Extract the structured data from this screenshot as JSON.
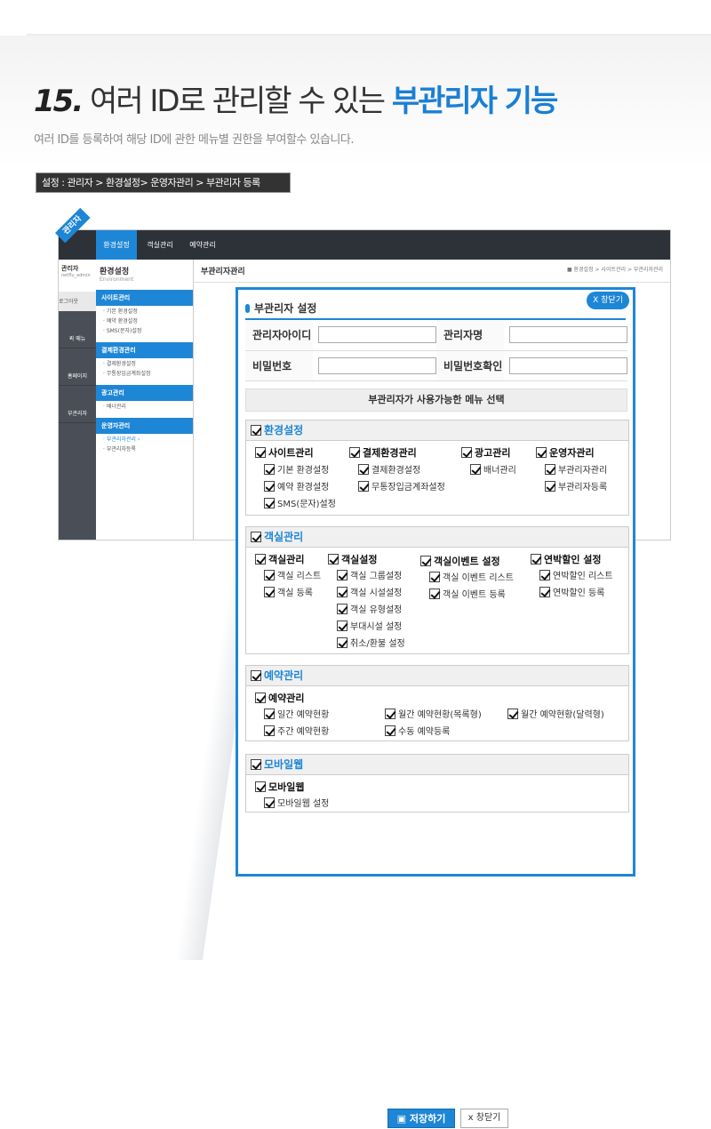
{
  "header": {
    "num": "15.",
    "title_plain": " 여러 ID로 관리할 수 있는 ",
    "title_highlight": "부관리자 기능",
    "subtitle": "여러 ID를 등록하여 해당 ID에 관한 메뉴별 권한을 부여할수 있습니다.",
    "path": "설정 : 관리자 > 환경설정> 운영자관리 > 부관리자 등록"
  },
  "admin_bg": {
    "badge": "관리자",
    "tabs": [
      "환경설정",
      "객실관리",
      "예약관리"
    ],
    "user_label": "관리자",
    "user_id": "netflu_admin",
    "logout": "로그아웃",
    "nav_items": [
      "퀵 메뉴",
      "홈페이지",
      "부관리자"
    ],
    "menu_title": "환경설정",
    "menu_sub": "Environment",
    "sections": [
      {
        "title": "사이트관리",
        "items": [
          "· 기본 환경설정",
          "· 예약 환경설정",
          "· SMS(문자)설정"
        ]
      },
      {
        "title": "결제환경관리",
        "items": [
          "· 결제환경설정",
          "· 무통장입금계좌설정"
        ]
      },
      {
        "title": "광고관리",
        "items": [
          "· 배너관리"
        ]
      },
      {
        "title": "운영자관리",
        "items": [
          "· 부관리자관리 ›",
          "· 부관리자등록"
        ]
      }
    ],
    "content_title": "부관리자관리",
    "crumb": "■ 환경설정 > 사이트관리 > 부관리자관리"
  },
  "modal": {
    "close_label": "X 창닫기",
    "title": "부관리자 설정",
    "fields": {
      "admin_id_label": "관리자아이디",
      "admin_name_label": "관리자명",
      "password_label": "비밀번호",
      "password_confirm_label": "비밀번호확인"
    },
    "menu_select_label": "부관리자가 사용가능한 메뉴 선택",
    "groups": [
      {
        "title": "환경설정",
        "cats": [
          {
            "label": "사이트관리",
            "opts": [
              "기본 환경설정",
              "예약 환경설정",
              "SMS(문자)설정"
            ]
          },
          {
            "label": "결제환경관리",
            "opts": [
              "결제환경설정",
              "무통장입금계좌설정"
            ]
          },
          {
            "label": "광고관리",
            "opts": [
              "배너관리"
            ]
          },
          {
            "label": "운영자관리",
            "opts": [
              "부관리자관리",
              "부관리자등록"
            ]
          }
        ]
      },
      {
        "title": "객실관리",
        "cats": [
          {
            "label": "객실관리",
            "opts": [
              "객실 리스트",
              "객실 등록"
            ]
          },
          {
            "label": "객실설정",
            "opts": [
              "객실 그룹설정",
              "객실 시설설정",
              "객실 유형설정",
              "부대시설 설정",
              "취소/환불 설정"
            ]
          },
          {
            "label": "객실이벤트 설정",
            "opts": [
              "객실 이벤트 리스트",
              "객실 이벤트 등록"
            ]
          },
          {
            "label": "연박할인 설정",
            "opts": [
              "연박할인 리스트",
              "연박할인 등록"
            ]
          }
        ]
      },
      {
        "title": "예약관리",
        "cats": [
          {
            "label": "예약관리",
            "opts": [
              "일간 예약현황",
              "주간 예약현황",
              "월간 예약현황(목록형)",
              "수동 예약등록",
              "월간 예약현황(달력형)"
            ]
          }
        ]
      },
      {
        "title": "모바일웹",
        "cats": [
          {
            "label": "모바일웹",
            "opts": [
              "모바일웹 설정"
            ]
          }
        ]
      }
    ],
    "save_label": "저장하기",
    "cancel_label": "창닫기"
  }
}
